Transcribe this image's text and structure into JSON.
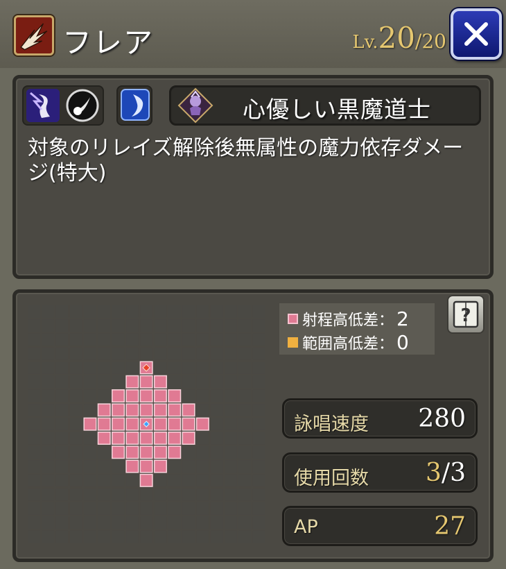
{
  "header": {
    "skill_name": "フレア",
    "level_prefix": "Lv.",
    "level_current": "20",
    "level_separator": "/",
    "level_max": "20"
  },
  "icons": {
    "skill": "flare-skill-icon",
    "element": "magic-element-icon",
    "effect": "comet-icon",
    "attack_type": "crescent-moon-icon",
    "class": "black-mage-emblem-icon",
    "close": "close-icon",
    "help": "help-book-icon"
  },
  "class_name": "心優しい黒魔道士",
  "description": "対象のリレイズ解除後無属性の魔力依存ダメージ(特大)",
  "range": {
    "legend": [
      {
        "label": "射程高低差：",
        "value": "2",
        "color": "#e07a93"
      },
      {
        "label": "範囲高低差：",
        "value": "0",
        "color": "#f0b040"
      }
    ]
  },
  "stats": [
    {
      "label": "詠唱速度",
      "value_main": "280",
      "value_sep": "",
      "value_rest": ""
    },
    {
      "label": "使用回数",
      "value_main": "3",
      "value_sep": "/",
      "value_rest": "3"
    },
    {
      "label": "AP",
      "value_main": "27",
      "value_sep": "",
      "value_rest": ""
    }
  ],
  "colors": {
    "range_fill": "#e07a93",
    "cell": "#4a4944",
    "gold": "#e5c770"
  }
}
